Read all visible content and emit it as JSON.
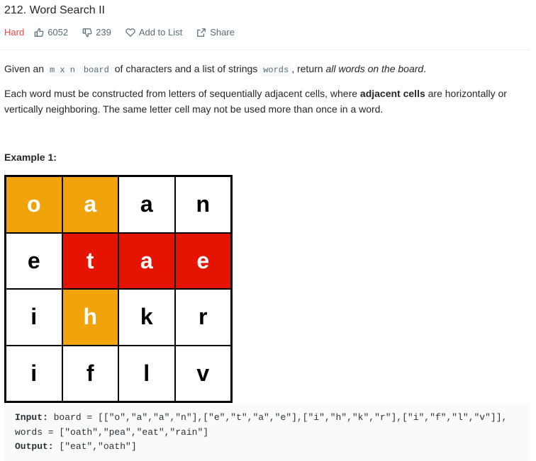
{
  "problem": {
    "title": "212. Word Search II",
    "difficulty": "Hard",
    "likes": "6052",
    "dislikes": "239",
    "add_to_list": "Add to List",
    "share": "Share"
  },
  "description": {
    "p1_before": "Given an ",
    "p1_code1": "m x n",
    "p1_code2": "board",
    "p1_mid": " of characters and a list of strings ",
    "p1_code3": "words",
    "p1_after": ", return ",
    "p1_em": "all words on the board",
    "p1_end": ".",
    "p2_before": "Each word must be constructed from letters of sequentially adjacent cells, where ",
    "p2_strong": "adjacent cells",
    "p2_after": " are horizontally or vertically neighboring. The same letter cell may not be used more than once in a word."
  },
  "example": {
    "title": "Example 1:",
    "board": [
      [
        {
          "ch": "o",
          "hl": "orange"
        },
        {
          "ch": "a",
          "hl": "orange"
        },
        {
          "ch": "a",
          "hl": ""
        },
        {
          "ch": "n",
          "hl": ""
        }
      ],
      [
        {
          "ch": "e",
          "hl": ""
        },
        {
          "ch": "t",
          "hl": "red"
        },
        {
          "ch": "a",
          "hl": "red"
        },
        {
          "ch": "e",
          "hl": "red"
        }
      ],
      [
        {
          "ch": "i",
          "hl": ""
        },
        {
          "ch": "h",
          "hl": "orange"
        },
        {
          "ch": "k",
          "hl": ""
        },
        {
          "ch": "r",
          "hl": ""
        }
      ],
      [
        {
          "ch": "i",
          "hl": ""
        },
        {
          "ch": "f",
          "hl": ""
        },
        {
          "ch": "l",
          "hl": ""
        },
        {
          "ch": "v",
          "hl": ""
        }
      ]
    ],
    "input_label": "Input:",
    "input_line1": " board = [[\"o\",\"a\",\"a\",\"n\"],[\"e\",\"t\",\"a\",\"e\"],[\"i\",\"h\",\"k\",\"r\"],[\"i\",\"f\",\"l\",\"v\"]],",
    "input_line2": "words = [\"oath\",\"pea\",\"eat\",\"rain\"]",
    "output_label": "Output:",
    "output_value": " [\"eat\",\"oath\"]"
  },
  "colors": {
    "orange": "#f0a30a",
    "red": "#e51400",
    "hard": "#ef4743"
  },
  "icons": [
    "thumbs-up-icon",
    "thumbs-down-icon",
    "heart-icon",
    "share-icon"
  ]
}
